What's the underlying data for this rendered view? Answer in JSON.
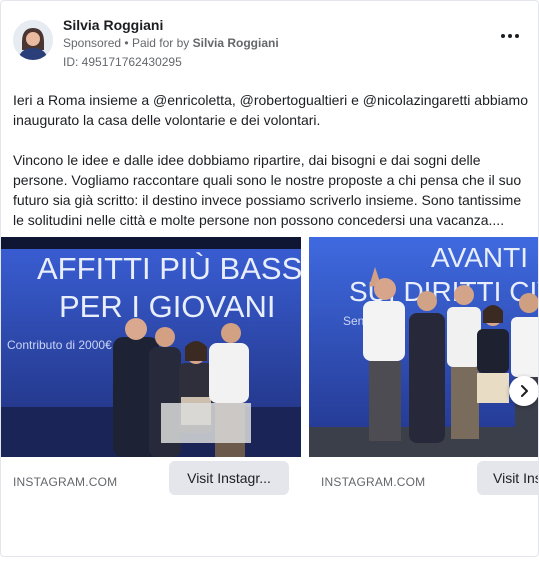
{
  "advertiser": {
    "name": "Silvia Roggiani",
    "sponsored_label": "Sponsored",
    "separator": "•",
    "paid_for_prefix": "Paid for by",
    "paid_for_name": "Silvia Roggiani",
    "ad_id": "ID: 495171762430295"
  },
  "menu_icon": "more-horizontal-icon",
  "post": {
    "paragraph1": "Ieri a Roma insieme a @enricoletta, @robertogualtieri e @nicolazingaretti abbiamo inaugurato la casa delle volontarie e dei volontari.",
    "paragraph2": "Vincono le idee e dalle idee dobbiamo ripartire, dai bisogni e dai sogni delle persone. Vogliamo raccontare quali sono le nostre proposte a chi pensa che il suo futuro sia già scritto: il destino invece possiamo scriverlo insieme. Sono tantissime le solitudini nelle città e molte persone non possono concedersi una vacanza...."
  },
  "carousel": {
    "cards": [
      {
        "banner_line1": "AFFITTI PIÙ BASSI",
        "banner_line2": "PER I GIOVANI",
        "banner_small": "Contributo di 2000€",
        "domain": "INSTAGRAM.COM",
        "cta": "Visit Instagr..."
      },
      {
        "banner_line1": "AVANTI",
        "banner_line2": "SUI DIRITTI CIVILI",
        "banner_small": "Sena",
        "domain": "INSTAGRAM.COM",
        "cta": "Visit Ins"
      }
    ],
    "next_icon": "chevron-right-icon"
  },
  "colors": {
    "stage_blue": "#2b4fc4",
    "text_primary": "#1c1e21",
    "text_secondary": "#65676b",
    "button_bg": "#e4e6eb"
  }
}
